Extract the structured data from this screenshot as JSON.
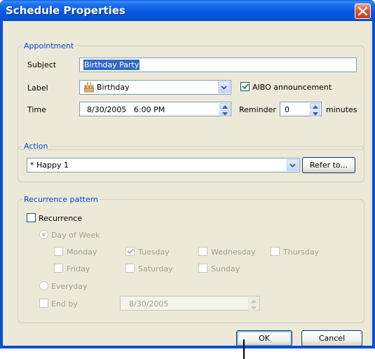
{
  "window": {
    "title": "Schedule Properties",
    "close_icon": "close-x-icon"
  },
  "appointment": {
    "legend": "Appointment",
    "subject_label": "Subject",
    "subject_value": "Birthday Party",
    "label_label": "Label",
    "label_value": "Birthday",
    "label_icon": "birthday-cake-icon",
    "aibo_label": "AIBO announcement",
    "aibo_checked": true,
    "time_label": "Time",
    "time_value": "8/30/2005   6:00 PM",
    "reminder_label": "Reminder",
    "reminder_value": "0",
    "minutes_label": "minutes"
  },
  "action": {
    "legend": "Action",
    "value": "* Happy 1",
    "refer_button": "Refer to..."
  },
  "recurrence": {
    "legend": "Recurrence pattern",
    "recurrence_label": "Recurrence",
    "recurrence_checked": false,
    "day_of_week_label": "Day of Week",
    "days": {
      "monday": "Monday",
      "tuesday": "Tuesday",
      "wednesday": "Wednesday",
      "thursday": "Thursday",
      "friday": "Friday",
      "saturday": "Saturday",
      "sunday": "Sunday"
    },
    "tuesday_checked": true,
    "everyday_label": "Everyday",
    "end_by_label": "End by",
    "end_by_value": "8/30/2005"
  },
  "buttons": {
    "ok": "OK",
    "cancel": "Cancel"
  },
  "colors": {
    "titlebar": "#0a5fe8",
    "dialog_bg": "#ece9d8",
    "group_legend": "#0046d5",
    "selection": "#316ac5",
    "close_button": "#e2552d"
  }
}
